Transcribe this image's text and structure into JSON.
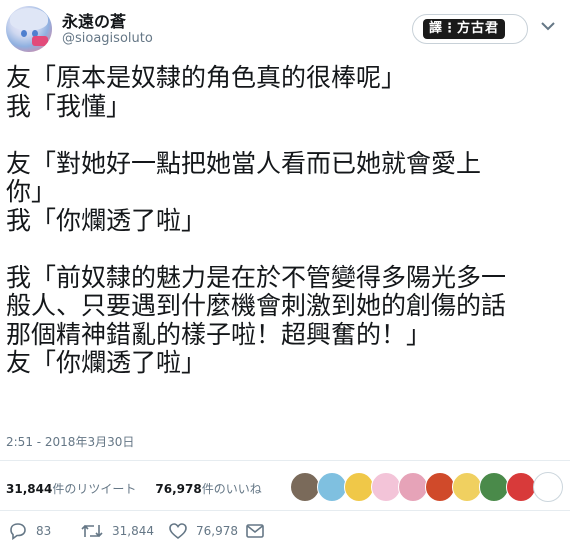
{
  "user": {
    "display_name": "永遠の蒼",
    "handle": "@sioagisoluto"
  },
  "translate": {
    "label": "譯⋮方古君"
  },
  "tweet": {
    "lines": [
      "友「原本是奴隸的角色真的很棒呢」",
      "我「我懂」",
      "",
      "友「對她好一點把她當人看而已她就會愛上",
      "你」",
      "我「你爛透了啦」",
      "",
      "我「前奴隸的魅力是在於不管變得多陽光多一",
      "般人、只要遇到什麼機會刺激到她的創傷的話",
      "那個精神錯亂的樣子啦！超興奮的！」",
      "友「你爛透了啦」"
    ],
    "timestamp": "2:51 - 2018年3月30日"
  },
  "stats": {
    "retweet_count": "31,844",
    "retweet_label": "件のリツイート",
    "like_count": "76,978",
    "like_label": "件のいいね"
  },
  "likers": [
    {
      "name": "liker-avatar-1",
      "color": "#7a6a5a"
    },
    {
      "name": "liker-avatar-2",
      "color": "#7fc0e0"
    },
    {
      "name": "liker-avatar-3",
      "color": "#f0c848"
    },
    {
      "name": "liker-avatar-4",
      "color": "#f3c4d8"
    },
    {
      "name": "liker-avatar-5",
      "color": "#e6a3b8"
    },
    {
      "name": "liker-avatar-6",
      "color": "#d04a2a"
    },
    {
      "name": "liker-avatar-7",
      "color": "#f0d060"
    },
    {
      "name": "liker-avatar-8",
      "color": "#4a8a4a"
    },
    {
      "name": "liker-avatar-9",
      "color": "#d83a3a"
    },
    {
      "name": "liker-avatar-10",
      "color": "#ffffff"
    }
  ],
  "actions": {
    "reply_count": "83",
    "retweet_count": "31,844",
    "like_count": "76,978"
  },
  "icons": {
    "reply": "reply-icon",
    "retweet": "retweet-icon",
    "like": "heart-icon",
    "dm": "envelope-icon",
    "more": "chevron-down-icon"
  }
}
